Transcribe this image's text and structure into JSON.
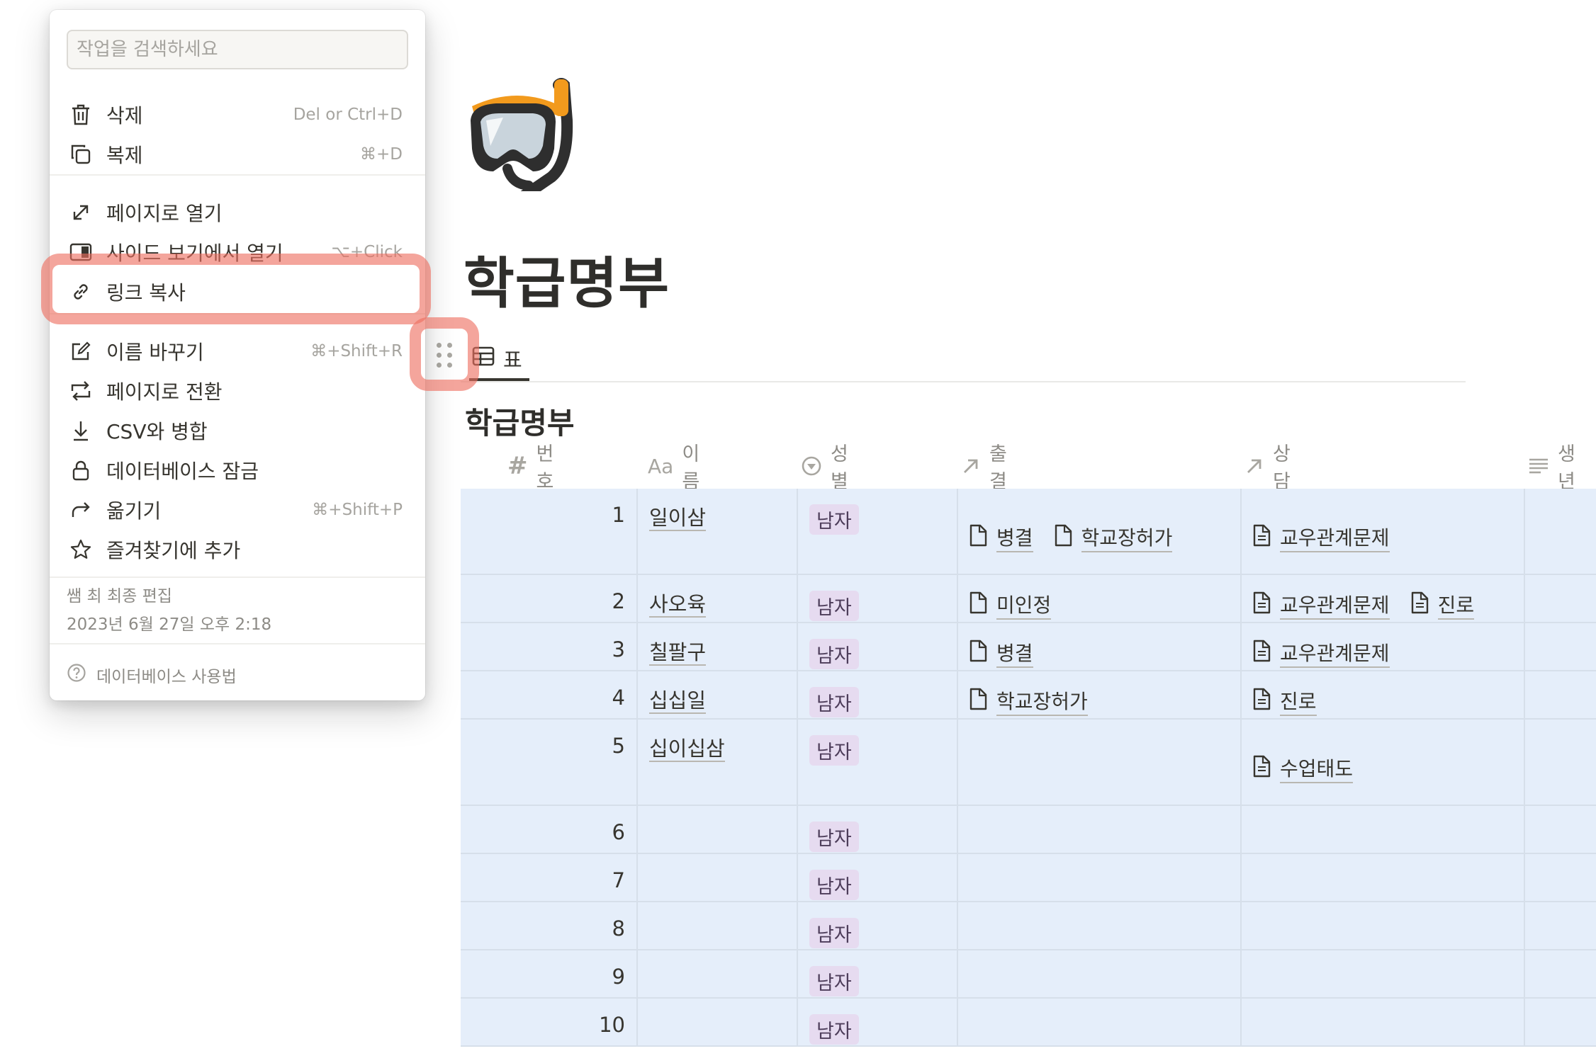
{
  "page": {
    "title": "학급명부"
  },
  "view": {
    "tab_label": "표"
  },
  "database": {
    "title": "학급명부",
    "columns": [
      {
        "icon": "number-icon",
        "label": "번호"
      },
      {
        "icon": "text-icon",
        "label": "이름"
      },
      {
        "icon": "select-icon",
        "label": "성별"
      },
      {
        "icon": "relation-arrow-icon",
        "label": "출결"
      },
      {
        "icon": "relation-arrow-icon",
        "label": "상담"
      },
      {
        "icon": "lines-icon",
        "label": "생년"
      }
    ],
    "rows": [
      {
        "num": "1",
        "name": "일이삼",
        "gender": "남자",
        "attendance": [
          "병결",
          "학교장허가"
        ],
        "counsel": [
          "교우관계문제"
        ]
      },
      {
        "num": "2",
        "name": "사오육",
        "gender": "남자",
        "attendance": [
          "미인정"
        ],
        "counsel": [
          "교우관계문제",
          "진로"
        ]
      },
      {
        "num": "3",
        "name": "칠팔구",
        "gender": "남자",
        "attendance": [
          "병결"
        ],
        "counsel": [
          "교우관계문제"
        ]
      },
      {
        "num": "4",
        "name": "십십일",
        "gender": "남자",
        "attendance": [
          "학교장허가"
        ],
        "counsel": [
          "진로"
        ]
      },
      {
        "num": "5",
        "name": "십이십삼",
        "gender": "남자",
        "attendance": [],
        "counsel": [
          "수업태도"
        ]
      },
      {
        "num": "6",
        "name": "",
        "gender": "남자",
        "attendance": [],
        "counsel": []
      },
      {
        "num": "7",
        "name": "",
        "gender": "남자",
        "attendance": [],
        "counsel": []
      },
      {
        "num": "8",
        "name": "",
        "gender": "남자",
        "attendance": [],
        "counsel": []
      },
      {
        "num": "9",
        "name": "",
        "gender": "남자",
        "attendance": [],
        "counsel": []
      },
      {
        "num": "10",
        "name": "",
        "gender": "남자",
        "attendance": [],
        "counsel": []
      }
    ]
  },
  "menu": {
    "search_placeholder": "작업을 검색하세요",
    "items": [
      {
        "icon": "trash-icon",
        "label": "삭제",
        "shortcut": "Del or Ctrl+D"
      },
      {
        "icon": "duplicate-icon",
        "label": "복제",
        "shortcut": "⌘+D"
      },
      {
        "icon": "open-page-icon",
        "label": "페이지로 열기",
        "shortcut": ""
      },
      {
        "icon": "side-peek-icon",
        "label": "사이드 보기에서 열기",
        "shortcut": "⌥+Click"
      },
      {
        "icon": "link-icon",
        "label": "링크 복사",
        "shortcut": ""
      },
      {
        "icon": "rename-icon",
        "label": "이름 바꾸기",
        "shortcut": "⌘+Shift+R"
      },
      {
        "icon": "convert-icon",
        "label": "페이지로 전환",
        "shortcut": ""
      },
      {
        "icon": "merge-csv-icon",
        "label": "CSV와 병합",
        "shortcut": ""
      },
      {
        "icon": "lock-icon",
        "label": "데이터베이스 잠금",
        "shortcut": ""
      },
      {
        "icon": "move-icon",
        "label": "옮기기",
        "shortcut": "⌘+Shift+P"
      },
      {
        "icon": "star-icon",
        "label": "즐겨찾기에 추가",
        "shortcut": ""
      }
    ],
    "last_edited_by": "쌤 최 최종 편집",
    "last_edited_time": "2023년 6월 27일 오후 2:18",
    "help_label": "데이터베이스 사용법"
  },
  "colors": {
    "highlight": "#ee6e60",
    "row_selected": "#e5eefa",
    "tag_purple": "#e6dbf0"
  }
}
